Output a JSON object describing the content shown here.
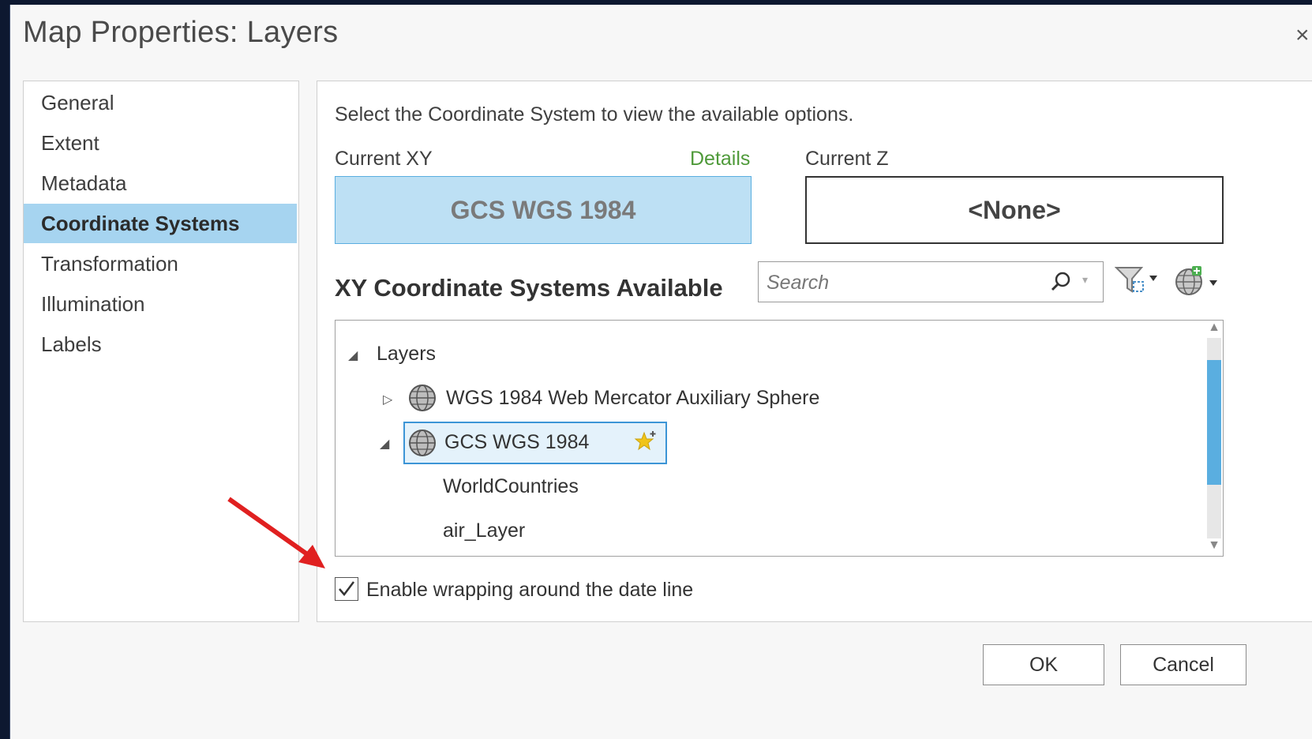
{
  "window": {
    "title": "Map Properties: Layers",
    "close_glyph": "×"
  },
  "sidebar": {
    "items": [
      {
        "label": "General",
        "active": false
      },
      {
        "label": "Extent",
        "active": false
      },
      {
        "label": "Metadata",
        "active": false
      },
      {
        "label": "Coordinate Systems",
        "active": true
      },
      {
        "label": "Transformation",
        "active": false
      },
      {
        "label": "Illumination",
        "active": false
      },
      {
        "label": "Labels",
        "active": false
      }
    ]
  },
  "content": {
    "instruction": "Select the Coordinate System to view the available options.",
    "current_xy_label": "Current XY",
    "details_link": "Details",
    "current_xy_value": "GCS WGS 1984",
    "current_z_label": "Current Z",
    "current_z_value": "<None>",
    "section_heading": "XY Coordinate Systems Available",
    "search": {
      "placeholder": "Search",
      "value": ""
    },
    "icons": [
      "search-icon",
      "filter-icon",
      "add-coordinate-system-icon"
    ],
    "tree": {
      "root": "Layers",
      "nodes": [
        {
          "label": "WGS 1984 Web Mercator Auxiliary Sphere",
          "expanded": false,
          "icon": "globe-icon"
        },
        {
          "label": "GCS WGS 1984",
          "expanded": true,
          "selected": true,
          "icon": "globe-icon",
          "badge": "favorite-star-icon",
          "children": [
            "WorldCountries",
            "air_Layer"
          ]
        }
      ]
    },
    "wrap_checkbox": {
      "label": "Enable wrapping around the date line",
      "checked": true
    }
  },
  "buttons": {
    "ok": "OK",
    "cancel": "Cancel"
  },
  "annotation": {
    "type": "red-arrow",
    "color": "#e02020",
    "points_to": "wrap-checkbox"
  }
}
